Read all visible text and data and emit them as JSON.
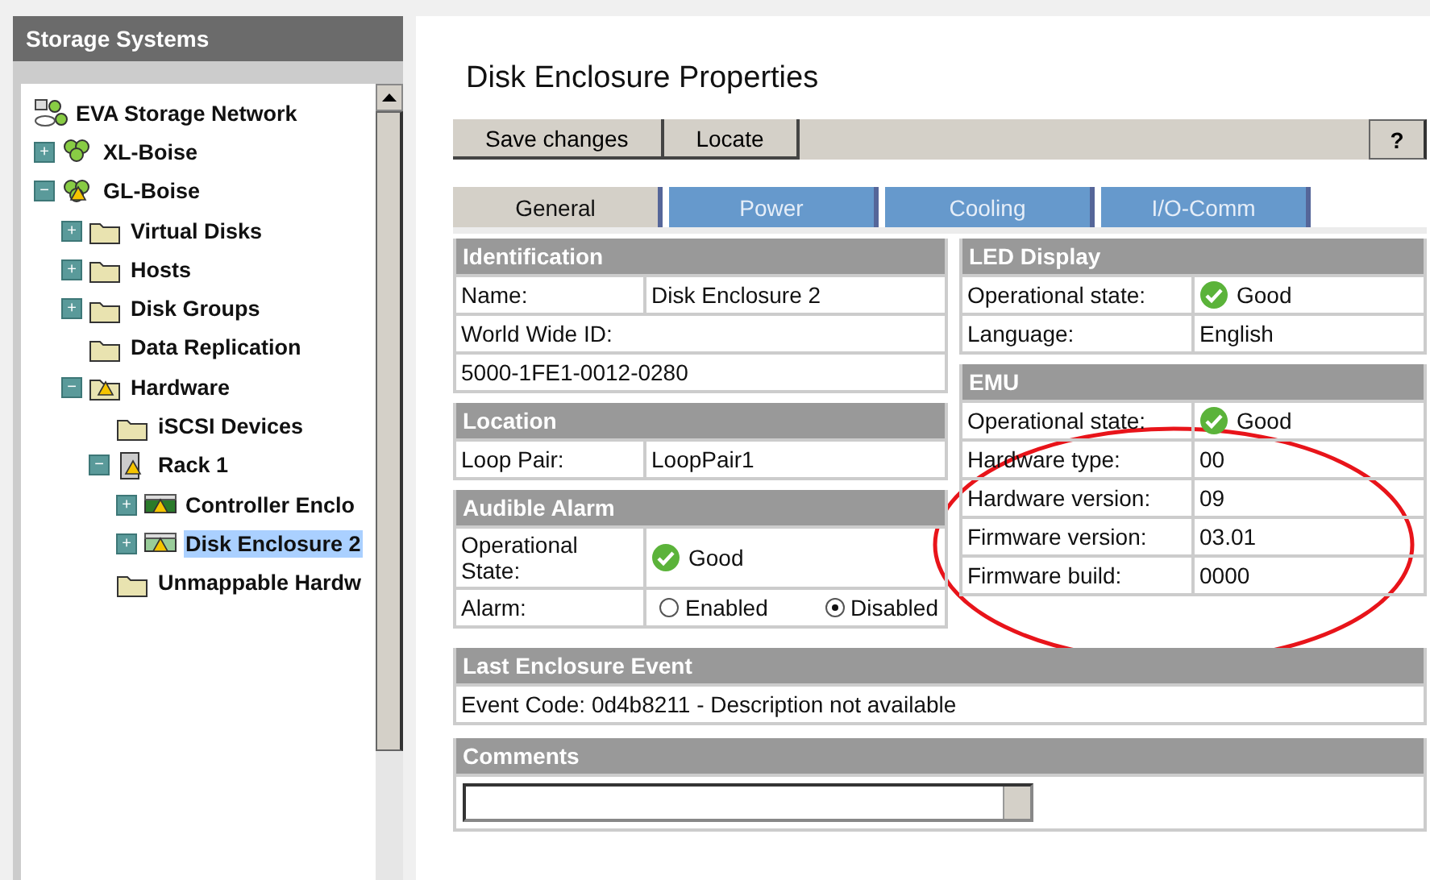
{
  "sidebar": {
    "title": "Storage Systems",
    "tree": [
      {
        "label": "EVA Storage Network",
        "kind": "network",
        "warning": false,
        "selected": false,
        "children": [
          {
            "label": "XL-Boise",
            "kind": "system",
            "warning": false,
            "toggle": "+",
            "selected": false
          },
          {
            "label": "GL-Boise",
            "kind": "system",
            "warning": true,
            "toggle": "−",
            "selected": false,
            "children": [
              {
                "label": "Virtual Disks",
                "kind": "folder",
                "warning": false,
                "toggle": "+",
                "selected": false
              },
              {
                "label": "Hosts",
                "kind": "folder",
                "warning": false,
                "toggle": "+",
                "selected": false
              },
              {
                "label": "Disk Groups",
                "kind": "folder",
                "warning": false,
                "toggle": "+",
                "selected": false
              },
              {
                "label": "Data Replication",
                "kind": "folder",
                "warning": false,
                "selected": false
              },
              {
                "label": "Hardware",
                "kind": "folder",
                "warning": true,
                "toggle": "−",
                "selected": false,
                "children": [
                  {
                    "label": "iSCSI Devices",
                    "kind": "folder",
                    "warning": false,
                    "selected": false
                  },
                  {
                    "label": "Rack 1",
                    "kind": "rack",
                    "warning": true,
                    "toggle": "−",
                    "selected": false,
                    "children": [
                      {
                        "label": "Controller Enclo",
                        "kind": "controller",
                        "warning": true,
                        "toggle": "+",
                        "selected": false
                      },
                      {
                        "label": "Disk Enclosure 2",
                        "kind": "disk",
                        "warning": true,
                        "toggle": "+",
                        "selected": true
                      }
                    ]
                  },
                  {
                    "label": "Unmappable Hardw",
                    "kind": "folder",
                    "warning": false,
                    "selected": false
                  }
                ]
              }
            ]
          }
        ]
      }
    ]
  },
  "page": {
    "title": "Disk Enclosure Properties",
    "toolbar": [
      "Save changes",
      "Locate"
    ],
    "help": "?",
    "tabs": [
      {
        "label": "General",
        "selected": true
      },
      {
        "label": "Power",
        "selected": false
      },
      {
        "label": "Cooling",
        "selected": false
      },
      {
        "label": "I/O-Comm",
        "selected": false
      }
    ],
    "left_sections": [
      {
        "title": "Identification",
        "rows": [
          {
            "kind": "pair",
            "label": "Name:",
            "value": "Disk Enclosure 2"
          },
          {
            "kind": "full",
            "value": "World Wide ID:"
          },
          {
            "kind": "full",
            "value": "5000-1FE1-0012-0280"
          }
        ]
      },
      {
        "title": "Location",
        "rows": [
          {
            "kind": "pair",
            "label": "Loop Pair:",
            "value": "LoopPair1"
          }
        ]
      },
      {
        "title": "Audible Alarm",
        "rows": [
          {
            "kind": "status",
            "label": "Operational State:",
            "value": "Good"
          },
          {
            "kind": "radio",
            "label": "Alarm:",
            "options": [
              {
                "label": "Enabled",
                "selected": false
              },
              {
                "label": "Disabled",
                "selected": true
              }
            ]
          }
        ]
      }
    ],
    "right_sections": [
      {
        "title": "LED Display",
        "rows": [
          {
            "kind": "status",
            "label": "Operational state:",
            "value": "Good"
          },
          {
            "kind": "pair",
            "label": "Language:",
            "value": "English"
          }
        ]
      },
      {
        "title": "EMU",
        "rows": [
          {
            "kind": "status",
            "label": "Operational state:",
            "value": "Good"
          },
          {
            "kind": "pair",
            "label": "Hardware type:",
            "value": "00"
          },
          {
            "kind": "pair",
            "label": "Hardware version:",
            "value": "09"
          },
          {
            "kind": "pair",
            "label": "Firmware version:",
            "value": "03.01"
          },
          {
            "kind": "pair",
            "label": "Firmware build:",
            "value": "0000"
          }
        ]
      }
    ],
    "event": {
      "title": "Last Enclosure Event",
      "text": "Event Code: 0d4b8211 - Description not available"
    },
    "comments": {
      "title": "Comments"
    }
  }
}
